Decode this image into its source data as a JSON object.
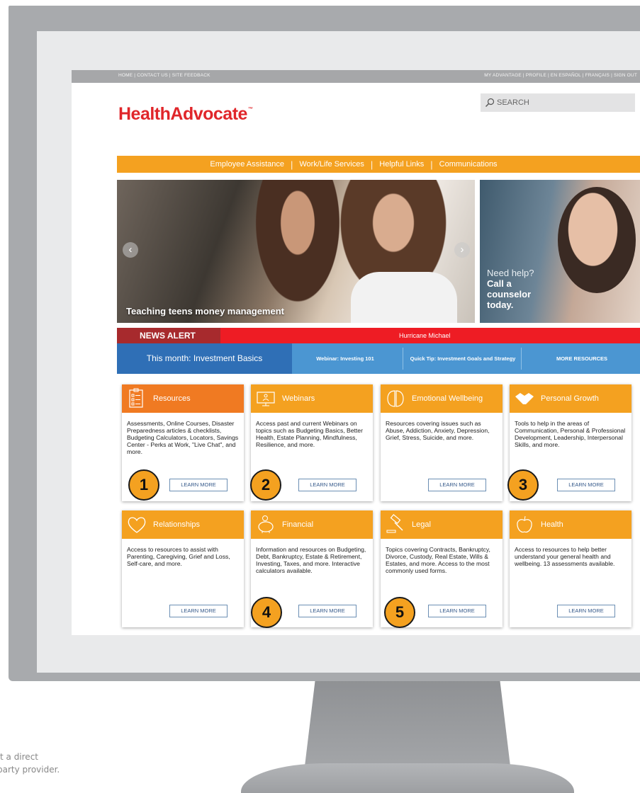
{
  "topbar": {
    "left_links": "HOME  |  CONTACT US  |  SITE FEEDBACK",
    "right_links": "MY ADVANTAGE  |  PROFILE  |  EN ESPAÑOL  |  FRANÇAIS  |  SIGN OUT"
  },
  "logo": {
    "text": "HealthAdvocate",
    "mark": "™"
  },
  "search": {
    "placeholder": "SEARCH",
    "icon": "search-icon"
  },
  "nav": [
    "Employee Assistance",
    "Work/Life Services",
    "Helpful Links",
    "Communications"
  ],
  "hero": {
    "caption": "Teaching teens money management"
  },
  "side_banner": {
    "line1": "Need help?",
    "line2": "Call a",
    "line3": "counselor",
    "line4": "today."
  },
  "alert": {
    "label": "NEWS ALERT",
    "text": "Hurricane Michael"
  },
  "infobar": {
    "month": "This month: Investment Basics",
    "webinar": "Webinar: Investing 101",
    "tip": "Quick Tip: Investment Goals and Strategy",
    "more": "MORE RESOURCES"
  },
  "cards": [
    {
      "title": "Resources",
      "body": "Assessments, Online Courses, Disaster Preparedness articles & checklists, Budgeting Calculators, Locators, Savings Center - Perks at Work, \"Live Chat\", and more.",
      "button": "LEARN MORE",
      "icon": "checklist-icon"
    },
    {
      "title": "Webinars",
      "body": "Access past and current Webinars on topics such as Budgeting Basics, Better Health, Estate Planning, Mindfulness, Resilience, and more.",
      "button": "LEARN MORE",
      "icon": "monitor-icon"
    },
    {
      "title": "Emotional Wellbeing",
      "body": "Resources covering issues such as Abuse, Addiction, Anxiety, Depression, Grief, Stress, Suicide, and more.",
      "button": "LEARN MORE",
      "icon": "brain-icon"
    },
    {
      "title": "Personal Growth",
      "body": "Tools to help in the areas of Communication, Personal & Professional Development, Leadership, Interpersonal Skills, and more.",
      "button": "LEARN MORE",
      "icon": "handshake-icon"
    },
    {
      "title": "Relationships",
      "body": "Access to resources to assist with Parenting, Caregiving, Grief and Loss, Self-care, and more.",
      "button": "LEARN MORE",
      "icon": "heart-icon"
    },
    {
      "title": "Financial",
      "body": "Information and resources on Budgeting, Debt, Bankruptcy, Estate & Retirement, Investing, Taxes, and more. Interactive calculators available.",
      "button": "LEARN MORE",
      "icon": "piggy-bank-icon"
    },
    {
      "title": "Legal",
      "body": "Topics covering Contracts, Bankruptcy, Divorce, Custody, Real Estate, Wills & Estates, and more. Access to the most commonly used forms.",
      "button": "LEARN MORE",
      "icon": "gavel-icon"
    },
    {
      "title": "Health",
      "body": "Access to resources to help better understand your general health and wellbeing. 13 assessments available.",
      "button": "LEARN MORE",
      "icon": "apple-icon"
    }
  ],
  "callouts": [
    "1",
    "2",
    "3",
    "4",
    "5"
  ],
  "footnote": {
    "line1": "t a direct",
    "line2": "party provider."
  },
  "colors": {
    "orange": "#f4a120",
    "dark_orange": "#f07a22",
    "red": "#ee1c24",
    "blue": "#4b96d2",
    "logo_red": "#e0262a"
  }
}
